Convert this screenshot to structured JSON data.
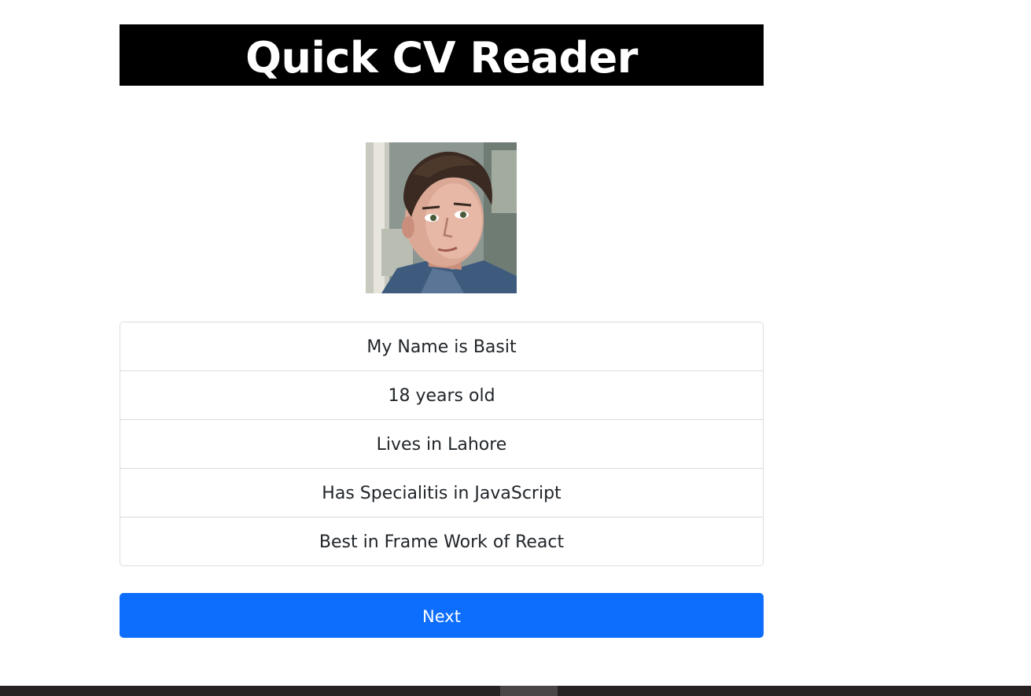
{
  "header": {
    "title": "Quick CV Reader"
  },
  "profile": {
    "photo_alt": "Profile photo"
  },
  "info": {
    "items": [
      {
        "text": "My Name is Basit"
      },
      {
        "text": "18 years old"
      },
      {
        "text": "Lives in Lahore"
      },
      {
        "text": "Has Specialitis in JavaScript"
      },
      {
        "text": "Best in Frame Work of React"
      }
    ]
  },
  "actions": {
    "next_label": "Next"
  },
  "colors": {
    "header_bg": "#000000",
    "header_text": "#ffffff",
    "button_bg": "#0d6efd",
    "button_text": "#ffffff",
    "list_border": "#dcdcdc",
    "taskbar_bg": "#262223"
  }
}
